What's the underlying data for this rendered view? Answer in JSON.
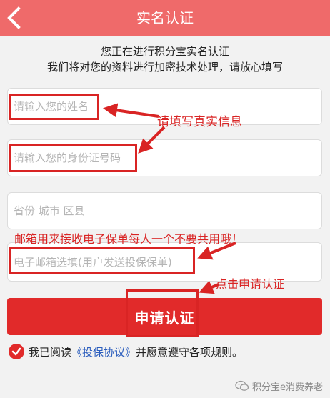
{
  "header": {
    "title": "实名认证",
    "back_icon": "chevron-left-icon"
  },
  "intro": {
    "line1": "您正在进行积分宝实名认证",
    "line2": "我们将对您的资料进行加密技术处理，请放心填写"
  },
  "form": {
    "name_placeholder": "请输入您的姓名",
    "id_placeholder": "请输入您的身份证号码",
    "region_placeholder": "省份 城市 区县",
    "email_placeholder": "电子邮箱选填(用户发送投保保单)"
  },
  "annotations": {
    "fill_true_info": "请填写真实信息",
    "email_note": "邮箱用来接收电子保单每人一个不要共用哦！",
    "click_apply": "点击申请认证"
  },
  "submit_label": "申请认证",
  "agreement": {
    "prefix": "我已阅读",
    "link": "《投保协议》",
    "suffix": "并愿意遵守各项规则。",
    "checked": true
  },
  "watermark": "积分宝e消费养老",
  "colors": {
    "header": "#ef6a6a",
    "primary": "#e12a2a",
    "annotation": "#d92424",
    "link": "#2b5dbd"
  }
}
